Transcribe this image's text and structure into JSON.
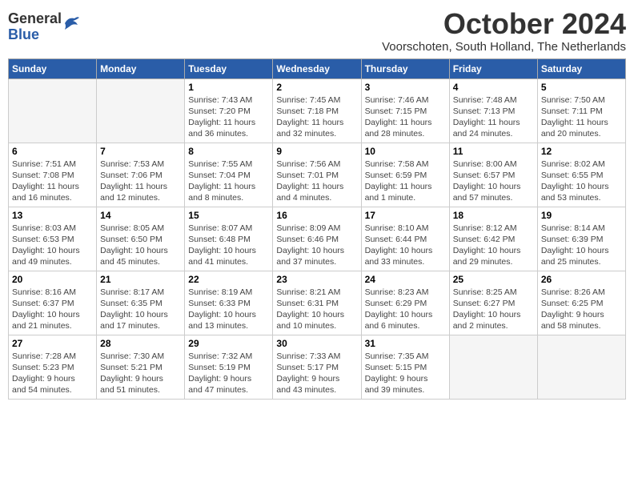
{
  "header": {
    "logo_general": "General",
    "logo_blue": "Blue",
    "month": "October 2024",
    "location": "Voorschoten, South Holland, The Netherlands"
  },
  "weekdays": [
    "Sunday",
    "Monday",
    "Tuesday",
    "Wednesday",
    "Thursday",
    "Friday",
    "Saturday"
  ],
  "weeks": [
    [
      {
        "day": null,
        "detail": null
      },
      {
        "day": null,
        "detail": null
      },
      {
        "day": "1",
        "detail": "Sunrise: 7:43 AM\nSunset: 7:20 PM\nDaylight: 11 hours\nand 36 minutes."
      },
      {
        "day": "2",
        "detail": "Sunrise: 7:45 AM\nSunset: 7:18 PM\nDaylight: 11 hours\nand 32 minutes."
      },
      {
        "day": "3",
        "detail": "Sunrise: 7:46 AM\nSunset: 7:15 PM\nDaylight: 11 hours\nand 28 minutes."
      },
      {
        "day": "4",
        "detail": "Sunrise: 7:48 AM\nSunset: 7:13 PM\nDaylight: 11 hours\nand 24 minutes."
      },
      {
        "day": "5",
        "detail": "Sunrise: 7:50 AM\nSunset: 7:11 PM\nDaylight: 11 hours\nand 20 minutes."
      }
    ],
    [
      {
        "day": "6",
        "detail": "Sunrise: 7:51 AM\nSunset: 7:08 PM\nDaylight: 11 hours\nand 16 minutes."
      },
      {
        "day": "7",
        "detail": "Sunrise: 7:53 AM\nSunset: 7:06 PM\nDaylight: 11 hours\nand 12 minutes."
      },
      {
        "day": "8",
        "detail": "Sunrise: 7:55 AM\nSunset: 7:04 PM\nDaylight: 11 hours\nand 8 minutes."
      },
      {
        "day": "9",
        "detail": "Sunrise: 7:56 AM\nSunset: 7:01 PM\nDaylight: 11 hours\nand 4 minutes."
      },
      {
        "day": "10",
        "detail": "Sunrise: 7:58 AM\nSunset: 6:59 PM\nDaylight: 11 hours\nand 1 minute."
      },
      {
        "day": "11",
        "detail": "Sunrise: 8:00 AM\nSunset: 6:57 PM\nDaylight: 10 hours\nand 57 minutes."
      },
      {
        "day": "12",
        "detail": "Sunrise: 8:02 AM\nSunset: 6:55 PM\nDaylight: 10 hours\nand 53 minutes."
      }
    ],
    [
      {
        "day": "13",
        "detail": "Sunrise: 8:03 AM\nSunset: 6:53 PM\nDaylight: 10 hours\nand 49 minutes."
      },
      {
        "day": "14",
        "detail": "Sunrise: 8:05 AM\nSunset: 6:50 PM\nDaylight: 10 hours\nand 45 minutes."
      },
      {
        "day": "15",
        "detail": "Sunrise: 8:07 AM\nSunset: 6:48 PM\nDaylight: 10 hours\nand 41 minutes."
      },
      {
        "day": "16",
        "detail": "Sunrise: 8:09 AM\nSunset: 6:46 PM\nDaylight: 10 hours\nand 37 minutes."
      },
      {
        "day": "17",
        "detail": "Sunrise: 8:10 AM\nSunset: 6:44 PM\nDaylight: 10 hours\nand 33 minutes."
      },
      {
        "day": "18",
        "detail": "Sunrise: 8:12 AM\nSunset: 6:42 PM\nDaylight: 10 hours\nand 29 minutes."
      },
      {
        "day": "19",
        "detail": "Sunrise: 8:14 AM\nSunset: 6:39 PM\nDaylight: 10 hours\nand 25 minutes."
      }
    ],
    [
      {
        "day": "20",
        "detail": "Sunrise: 8:16 AM\nSunset: 6:37 PM\nDaylight: 10 hours\nand 21 minutes."
      },
      {
        "day": "21",
        "detail": "Sunrise: 8:17 AM\nSunset: 6:35 PM\nDaylight: 10 hours\nand 17 minutes."
      },
      {
        "day": "22",
        "detail": "Sunrise: 8:19 AM\nSunset: 6:33 PM\nDaylight: 10 hours\nand 13 minutes."
      },
      {
        "day": "23",
        "detail": "Sunrise: 8:21 AM\nSunset: 6:31 PM\nDaylight: 10 hours\nand 10 minutes."
      },
      {
        "day": "24",
        "detail": "Sunrise: 8:23 AM\nSunset: 6:29 PM\nDaylight: 10 hours\nand 6 minutes."
      },
      {
        "day": "25",
        "detail": "Sunrise: 8:25 AM\nSunset: 6:27 PM\nDaylight: 10 hours\nand 2 minutes."
      },
      {
        "day": "26",
        "detail": "Sunrise: 8:26 AM\nSunset: 6:25 PM\nDaylight: 9 hours\nand 58 minutes."
      }
    ],
    [
      {
        "day": "27",
        "detail": "Sunrise: 7:28 AM\nSunset: 5:23 PM\nDaylight: 9 hours\nand 54 minutes."
      },
      {
        "day": "28",
        "detail": "Sunrise: 7:30 AM\nSunset: 5:21 PM\nDaylight: 9 hours\nand 51 minutes."
      },
      {
        "day": "29",
        "detail": "Sunrise: 7:32 AM\nSunset: 5:19 PM\nDaylight: 9 hours\nand 47 minutes."
      },
      {
        "day": "30",
        "detail": "Sunrise: 7:33 AM\nSunset: 5:17 PM\nDaylight: 9 hours\nand 43 minutes."
      },
      {
        "day": "31",
        "detail": "Sunrise: 7:35 AM\nSunset: 5:15 PM\nDaylight: 9 hours\nand 39 minutes."
      },
      {
        "day": null,
        "detail": null
      },
      {
        "day": null,
        "detail": null
      }
    ]
  ]
}
